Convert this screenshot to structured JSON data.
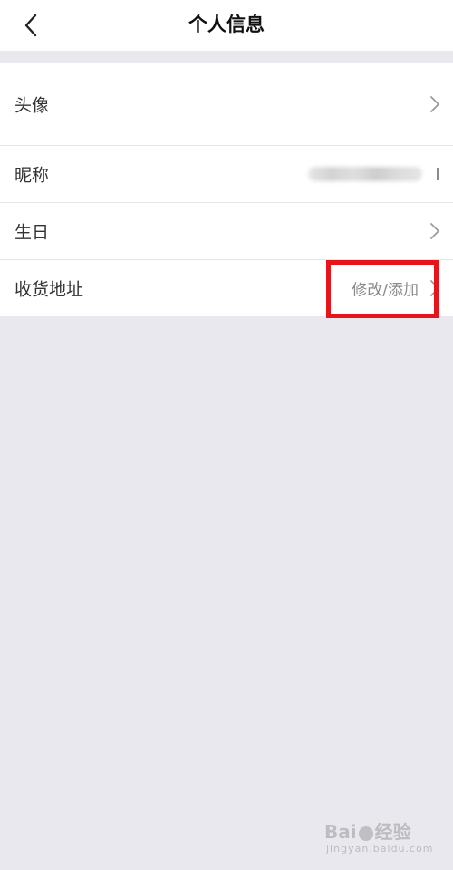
{
  "nav": {
    "back_icon": "chevron-left-icon",
    "title": "个人信息"
  },
  "rows": {
    "avatar": {
      "label": "头像",
      "icon": "chevron-right-icon"
    },
    "nickname": {
      "label": "昵称",
      "value_obscured": true
    },
    "birthday": {
      "label": "生日",
      "icon": "chevron-right-icon"
    },
    "address": {
      "label": "收货地址",
      "value": "修改/添加",
      "icon": "chevron-right-icon"
    }
  },
  "annotation": {
    "highlight_color": "#e8141c"
  },
  "colors": {
    "background": "#e8e8ee",
    "surface": "#ffffff",
    "text_primary": "#333333",
    "text_secondary": "#8a8a8a"
  }
}
